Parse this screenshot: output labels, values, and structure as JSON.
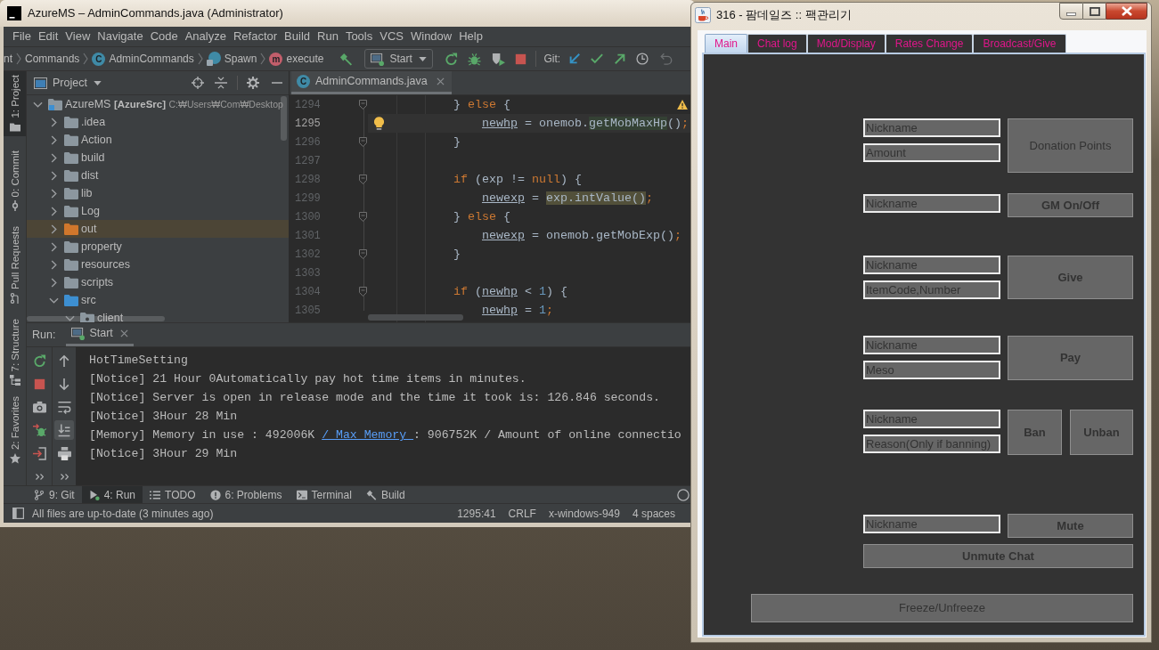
{
  "ide_window": {
    "title": "AzureMS – AdminCommands.java (Administrator)",
    "menu": [
      "File",
      "Edit",
      "View",
      "Navigate",
      "Code",
      "Analyze",
      "Refactor",
      "Build",
      "Run",
      "Tools",
      "VCS",
      "Window",
      "Help"
    ],
    "breadcrumbs": [
      {
        "label": "nt",
        "kind": "plain"
      },
      {
        "label": "Commands",
        "kind": "plain"
      },
      {
        "label": "AdminCommands",
        "kind": "class",
        "badge": "C"
      },
      {
        "label": "Spawn",
        "kind": "anonymous"
      },
      {
        "label": "execute",
        "kind": "method",
        "badge": "m"
      }
    ],
    "run_config": "Start",
    "git_label": "Git:",
    "tool_strip": [
      {
        "label": "1: Project",
        "kind": "project",
        "selected": true
      },
      {
        "label": "0: Commit",
        "kind": "commit",
        "selected": false
      },
      {
        "label": "Pull Requests",
        "kind": "pull_requests",
        "selected": false
      },
      {
        "label": "7: Structure",
        "kind": "structure",
        "selected": false
      },
      {
        "label": "2: Favorites",
        "kind": "favorites",
        "selected": false
      }
    ],
    "project_panel": {
      "title": "Project",
      "tree": [
        {
          "name": "AzureMS",
          "module": "[AzureSrc]",
          "path": "C:₩Users₩Com₩Desktop",
          "kind": "module",
          "expanded": true,
          "selected": false,
          "children": [
            {
              "name": ".idea",
              "kind": "folder",
              "expanded": false,
              "selected": false
            },
            {
              "name": "Action",
              "kind": "folder",
              "expanded": false,
              "selected": false
            },
            {
              "name": "build",
              "kind": "folder",
              "expanded": false,
              "selected": false
            },
            {
              "name": "dist",
              "kind": "folder",
              "expanded": false,
              "selected": false
            },
            {
              "name": "lib",
              "kind": "folder",
              "expanded": false,
              "selected": false
            },
            {
              "name": "Log",
              "kind": "folder",
              "expanded": false,
              "selected": false
            },
            {
              "name": "out",
              "kind": "excluded",
              "expanded": false,
              "selected": true
            },
            {
              "name": "property",
              "kind": "folder",
              "expanded": false,
              "selected": false
            },
            {
              "name": "resources",
              "kind": "folder",
              "expanded": false,
              "selected": false
            },
            {
              "name": "scripts",
              "kind": "folder",
              "expanded": false,
              "selected": false
            },
            {
              "name": "src",
              "kind": "source",
              "expanded": true,
              "selected": false,
              "children": [
                {
                  "name": "client",
                  "kind": "package",
                  "expanded": true,
                  "selected": false
                }
              ]
            }
          ]
        }
      ]
    },
    "editor": {
      "tab": {
        "label": "AdminCommands.java",
        "badge": "C"
      },
      "lines": [
        {
          "number": "1294",
          "current": false,
          "fold": true,
          "tokens": [
            {
              "text": "            } ",
              "kind": "plain"
            },
            {
              "text": "else",
              "kind": "keyword"
            },
            {
              "text": " {",
              "kind": "plain"
            }
          ]
        },
        {
          "number": "1295",
          "current": true,
          "fold": false,
          "tokens": [
            {
              "text": "                newhp",
              "kind": "var"
            },
            {
              "text": " = onemob.",
              "kind": "plain"
            },
            {
              "text": "getMobMaxHp",
              "kind": "match"
            },
            {
              "text": "()",
              "kind": "plain"
            },
            {
              "text": ";",
              "kind": "keyword"
            }
          ]
        },
        {
          "number": "1296",
          "current": false,
          "fold": true,
          "tokens": [
            {
              "text": "            }",
              "kind": "plain"
            }
          ]
        },
        {
          "number": "1297",
          "current": false,
          "fold": false
        },
        {
          "number": "1298",
          "current": false,
          "fold": true,
          "tokens": [
            {
              "text": "            if",
              "kind": "keyword"
            },
            {
              "text": " (exp != ",
              "kind": "plain"
            },
            {
              "text": "null",
              "kind": "keyword"
            },
            {
              "text": ") {",
              "kind": "plain"
            }
          ]
        },
        {
          "number": "1299",
          "current": false,
          "fold": false,
          "tokens": [
            {
              "text": "                newexp",
              "kind": "var"
            },
            {
              "text": " = ",
              "kind": "plain"
            },
            {
              "text": "exp.intValue()",
              "kind": "found"
            },
            {
              "text": ";",
              "kind": "keyword"
            }
          ]
        },
        {
          "number": "1300",
          "current": false,
          "fold": true,
          "tokens": [
            {
              "text": "            } ",
              "kind": "plain"
            },
            {
              "text": "else",
              "kind": "keyword"
            },
            {
              "text": " {",
              "kind": "plain"
            }
          ]
        },
        {
          "number": "1301",
          "current": false,
          "fold": false,
          "tokens": [
            {
              "text": "                newexp",
              "kind": "var"
            },
            {
              "text": " = onemob.getMobExp()",
              "kind": "plain"
            },
            {
              "text": ";",
              "kind": "keyword"
            }
          ]
        },
        {
          "number": "1302",
          "current": false,
          "fold": true,
          "tokens": [
            {
              "text": "            }",
              "kind": "plain"
            }
          ]
        },
        {
          "number": "1303",
          "current": false,
          "fold": false
        },
        {
          "number": "1304",
          "current": false,
          "fold": true,
          "tokens": [
            {
              "text": "            if",
              "kind": "keyword"
            },
            {
              "text": " (",
              "kind": "plain"
            },
            {
              "text": "newhp",
              "kind": "var"
            },
            {
              "text": " < ",
              "kind": "plain"
            },
            {
              "text": "1",
              "kind": "number"
            },
            {
              "text": ") {",
              "kind": "plain"
            }
          ]
        },
        {
          "number": "1305",
          "current": false,
          "fold": false,
          "tokens": [
            {
              "text": "                newhp",
              "kind": "var"
            },
            {
              "text": " = ",
              "kind": "plain"
            },
            {
              "text": "1",
              "kind": "number"
            },
            {
              "text": ";",
              "kind": "keyword"
            }
          ]
        }
      ]
    },
    "run_panel": {
      "label": "Run:",
      "tab": "Start",
      "scroll_to_end": true,
      "console": [
        {
          "segments": [
            {
              "text": "HotTimeSetting",
              "kind": "text"
            }
          ]
        },
        {
          "segments": [
            {
              "text": "[Notice] 21 Hour 0Automatically pay hot time items in minutes.",
              "kind": "text"
            }
          ]
        },
        {
          "segments": [
            {
              "text": "[Notice] Server is open in release mode and the time it took is: 126.846 seconds.",
              "kind": "text"
            }
          ]
        },
        {
          "segments": [
            {
              "text": "[Notice] 3Hour 28 Min",
              "kind": "text"
            }
          ]
        },
        {
          "segments": [
            {
              "text": "[Memory] Memory in use : 492006K ",
              "kind": "text"
            },
            {
              "text": "/ Max Memory ",
              "kind": "link"
            },
            {
              "text": ": 906752K / Amount of online connectio",
              "kind": "text"
            }
          ]
        },
        {
          "segments": [
            {
              "text": "[Notice] 3Hour 29 Min",
              "kind": "text"
            }
          ]
        }
      ]
    },
    "bottom_tabs": [
      {
        "label": "9: Git",
        "kind": "git",
        "selected": false
      },
      {
        "label": "4: Run",
        "kind": "run",
        "selected": true
      },
      {
        "label": "TODO",
        "kind": "todo",
        "selected": false
      },
      {
        "label": "6: Problems",
        "kind": "problems",
        "selected": false
      },
      {
        "label": "Terminal",
        "kind": "terminal",
        "selected": false
      },
      {
        "label": "Build",
        "kind": "build",
        "selected": false
      }
    ],
    "status_bar": {
      "message": "All files are up-to-date (3 minutes ago)",
      "items": [
        "1295:41",
        "CRLF",
        "x-windows-949",
        "4 spaces"
      ]
    }
  },
  "admin_window": {
    "title": "316 - 팜데일즈 :: 팩관리기",
    "tabs": [
      {
        "label": "Main",
        "selected": true
      },
      {
        "label": "Chat log",
        "selected": false
      },
      {
        "label": "Mod/Display",
        "selected": false
      },
      {
        "label": "Rates Change",
        "selected": false
      },
      {
        "label": "Broadcast/Give",
        "selected": false
      }
    ],
    "sections": [
      {
        "fields": [
          {
            "placeholder": "Nickname"
          },
          {
            "placeholder": "Amount"
          }
        ],
        "buttons": [
          {
            "label": "Donation Points",
            "bold": false
          }
        ]
      },
      {
        "fields": [
          {
            "placeholder": "Nickname"
          }
        ],
        "buttons": [
          {
            "label": "GM On/Off",
            "bold": true
          }
        ]
      },
      {
        "fields": [
          {
            "placeholder": "Nickname"
          },
          {
            "placeholder": "ItemCode,Number"
          }
        ],
        "buttons": [
          {
            "label": "Give",
            "bold": true
          }
        ]
      },
      {
        "fields": [
          {
            "placeholder": "Nickname"
          },
          {
            "placeholder": "Meso"
          }
        ],
        "buttons": [
          {
            "label": "Pay",
            "bold": true
          }
        ]
      },
      {
        "fields": [
          {
            "placeholder": "Nickname"
          },
          {
            "placeholder": "Reason(Only if banning)"
          }
        ],
        "buttons": [
          {
            "label": "Ban",
            "bold": true
          },
          {
            "label": "Unban",
            "bold": true
          }
        ]
      },
      {
        "fields": [
          {
            "placeholder": "Nickname"
          }
        ],
        "buttons": [
          {
            "label": "Mute",
            "bold": true
          }
        ],
        "wide_buttons": [
          {
            "label": "Unmute Chat",
            "bold": true
          }
        ]
      },
      {
        "wide_buttons": [
          {
            "label": "Freeze/Unfreeze",
            "bold": false
          }
        ]
      }
    ]
  }
}
